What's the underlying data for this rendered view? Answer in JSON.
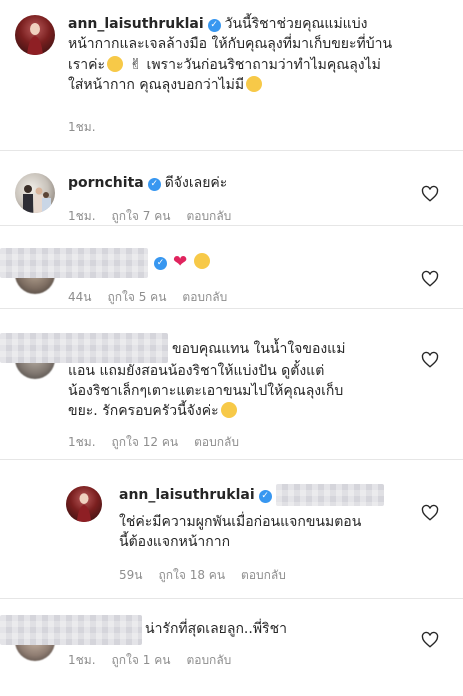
{
  "comments": [
    {
      "username": "ann_laisuthruklai",
      "verified": true,
      "text_line1": "วันนี้ริชาช่วยคุณแม่แบ่ง",
      "text_line2": "หน้ากากและเจลล้างมือ ให้กับคุณลุงที่มาเก็บขยะที่บ้าน",
      "text_line3a": "เราค่ะ",
      "text_line3b": " เพราะวันก่อนริชาถามว่าทำไมคุณลุงไม่",
      "text_line4": "ใส่หน้ากาก คุณลุงบอกว่าไม่มี",
      "time": "1ชม.",
      "emoji1": "smiling-face-emoji",
      "emoji2": "victory-hand-emoji",
      "emoji3": "relieved-face-emoji"
    },
    {
      "username": "pornchita",
      "verified": true,
      "text": "ดีจังเลยค่ะ",
      "time": "1ชม.",
      "likes": "ถูกใจ 7 คน",
      "reply": "ตอบกลับ"
    },
    {
      "username_redacted": true,
      "verified": true,
      "heart": "❤",
      "emoji": "kissing-face-emoji",
      "time": "44น",
      "likes": "ถูกใจ 5 คน",
      "reply": "ตอบกลับ"
    },
    {
      "username_redacted": true,
      "text_line1": "ขอบคุณแทน ในน้ำใจของแม่",
      "text_line2": "แอน แถมยังสอนน้องริชาให้แบ่งปัน ดูตั้งแต่",
      "text_line3": "น้องริชาเล็กๆเตาะแตะเอาขนมไปให้คุณลุงเก็บ",
      "text_line4": "ขยะ. รักครอบครัวนี้จังค่ะ",
      "time": "1ชม.",
      "likes": "ถูกใจ 12 คน",
      "reply": "ตอบกลับ"
    },
    {
      "username": "ann_laisuthruklai",
      "verified": true,
      "text_line1": "ใช่ค่ะมีความผูกพันเมื่อก่อนแจกขนมตอน",
      "text_line2": "นี้ต้องแจกหน้ากาก",
      "time": "59น",
      "likes": "ถูกใจ 18 คน",
      "reply": "ตอบกลับ"
    },
    {
      "username_redacted": true,
      "text": "น่ารักที่สุดเลยลูก..พี่ริชา",
      "time": "1ชม.",
      "likes": "ถูกใจ 1 คน",
      "reply": "ตอบกลับ"
    }
  ]
}
